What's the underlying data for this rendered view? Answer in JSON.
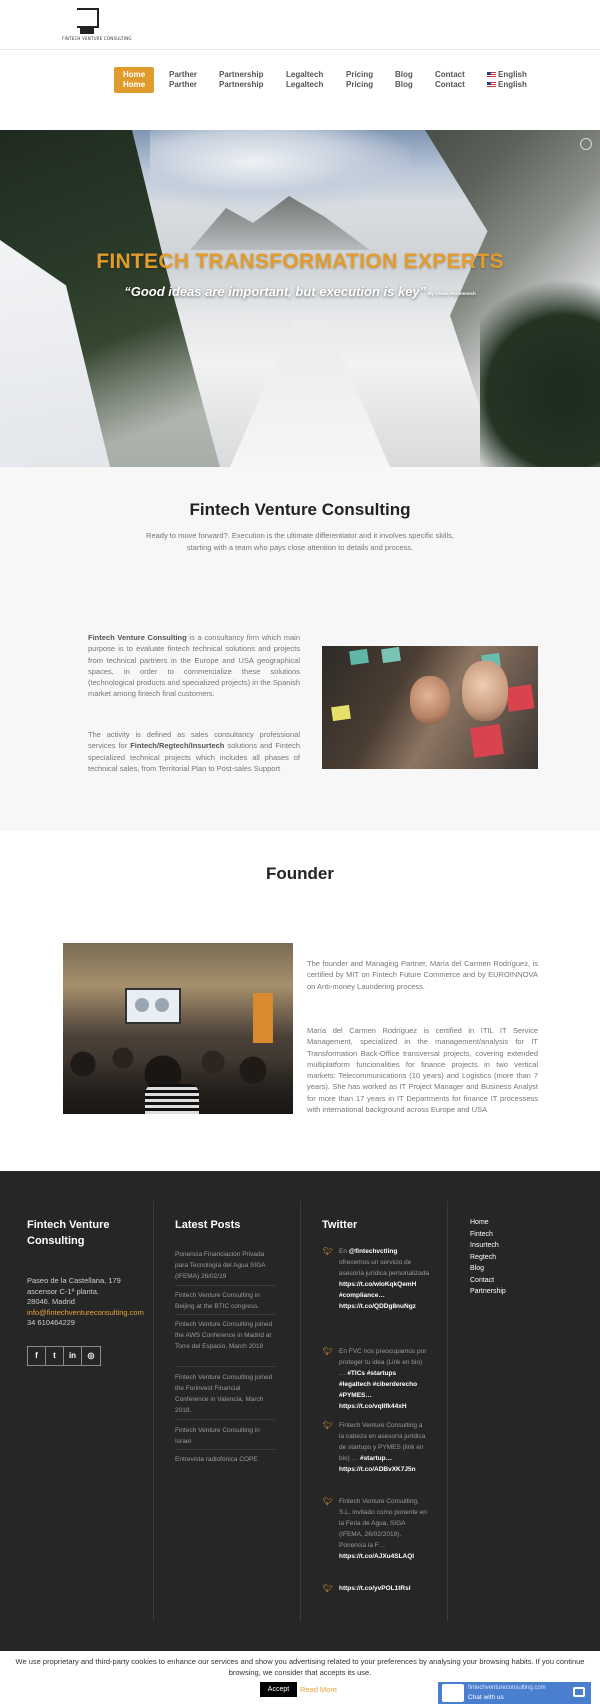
{
  "header": {
    "logo_text": "FINTECH VENTURE CONSULTING",
    "nav": [
      {
        "label": "Home",
        "hover": "Home"
      },
      {
        "label": "Parther",
        "hover": "Parther"
      },
      {
        "label": "Partnership",
        "hover": "Partnership"
      },
      {
        "label": "Legaltech",
        "hover": "Legaltech"
      },
      {
        "label": "Pricing",
        "hover": "Pricing"
      },
      {
        "label": "Blog",
        "hover": "Blog"
      },
      {
        "label": "Contact",
        "hover": "Contact"
      },
      {
        "label": "English",
        "hover": "English"
      }
    ],
    "accent_color": "#e09b2d"
  },
  "hero": {
    "title": "FINTECH TRANSFORMATION EXPERTS",
    "quote": "“Good ideas are important, but execution is key”",
    "attribution": "By Gleeia Abramovich"
  },
  "intro": {
    "title": "Fintech Venture Consulting",
    "subtitle": "Ready to move forward?. Execution is the ultimate differentiator and it involves specific skills, starting with a team who pays close attention to details and process.",
    "p1_bold": "Fintech Venture Consulting",
    "p1_rest": " is a consultancy firm which main purpose is to evaluate fintech technical solutions and projects from technical partners in the Europe and USA geographical spaces, in order to commercialize these solutions (technological products and specialized projects) in the Spanish market among fintech final customers.",
    "p2_start": "The activity is defined as sales consultancy professional services for ",
    "p2_bold": "Fintech/Regtech/Insurtech",
    "p2_rest": " solutions and Fintech specialized technical projects which includes all phases of technical sales, from Territorial Plan to Post-sales Support"
  },
  "founder": {
    "title": "Founder",
    "p1": "The founder and Managing Partner, María del Carmen Rodríguez, is certified by MIT on Fintech Future Commerce and by EUROINNOVA on Anti-money Laundering process.",
    "p2": "María del Carmen Rodríguez is certified in ITIL IT Service Management, specialized in the management/analysis for IT Transformation Back-Office transversal projects, covering extended multiplatform funcionalities for finance projects in two vertical markets: Telecommunications (10 years) and Logistics (more than 7 years). She has worked as IT Project Manager and Business Analyst for more than 17 years in IT Departments for finance IT processess with international background across Europe and USA"
  },
  "footer": {
    "company": {
      "title": "Fintech Venture Consulting",
      "address1": "Paseo de la Castellana, 179",
      "address2": "ascensor C-1ª planta.",
      "address3": "28046. Madrid",
      "email": "info@fintechventureconsulting.com",
      "phone": "34 610464229",
      "social": [
        "f",
        "t",
        "in",
        "◎"
      ]
    },
    "posts": {
      "title": "Latest Posts",
      "items": [
        "Ponencia Financiación Privada para Tecnología del Agua SIGA (IFEMA) 26/02/19",
        "Fintech Venture Consulting in Beijing at the BTIC congress.",
        "Fintech Venture Consulting joined the AWS Conference in Madrid at Torre del Espacio, March 2018",
        "Fintech Venture Consulting joined the Forinvest Financial Conference in Valencia, March 2018.",
        "Fintech Venture Consulting in Israel",
        "Entrevista radiofónica COPE"
      ]
    },
    "twitter": {
      "title": "Twitter",
      "tweets": [
        {
          "pre": "En ",
          "handle": "@fintechvctling",
          "text": " ofrecemos un servicio de asesoría jurídica personalizada ",
          "link": "https://t.co/wIoKqkQemH #compliance… https://t.co/QDDg8nuNgz"
        },
        {
          "pre": "",
          "handle": "",
          "text": "En FVC nos preocupamos por proteger tu idea (Link en bio) … ",
          "link": "#TICs #startups #legaltech #ciberderecho #PYMES… https://t.co/vqIIfk44xH"
        },
        {
          "pre": "",
          "handle": "",
          "text": "Fintech Venture Consulting a la cabeza en asesoría jurídica de startups y PYMES (link en bio) … ",
          "link": "#startup… https://t.co/ADBvXK7J5n"
        },
        {
          "pre": "",
          "handle": "",
          "text": "Fintech Venture Consulting, S.L. invitado como ponente en la Feria de Agua, SIGA (IFEMA, 26/02/2019). Ponencia la F… ",
          "link": "https://t.co/AJXu4SLAQI"
        },
        {
          "pre": "",
          "handle": "",
          "text": "",
          "link": "https://t.co/yvPOL1tRsl"
        }
      ]
    },
    "menu": [
      "Home",
      "Fintech",
      "Insurtech",
      "Regtech",
      "Blog",
      "Contact",
      "Partnership"
    ]
  },
  "cookie": {
    "text": "We use proprietary and third-party cookies to enhance our services and show you advertising related to your preferences by analysing your browsing habits. If you continue browsing, we consider that accepts its use.",
    "accept": "Accept",
    "read_more": "Read More"
  },
  "chat": {
    "site": "fintechventureconsulting.com",
    "label": "Chat with us"
  }
}
